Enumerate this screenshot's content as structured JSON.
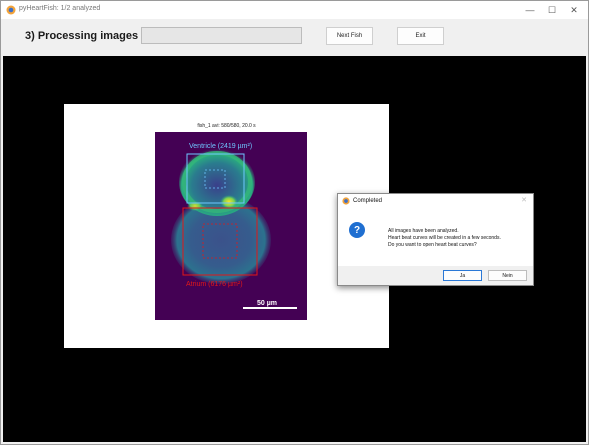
{
  "window": {
    "title": "pyHeartFish: 1/2 analyzed",
    "minimize_glyph": "—",
    "maximize_glyph": "☐",
    "close_glyph": "✕"
  },
  "toolbar": {
    "section_title": "3) Processing images",
    "progress": 0,
    "next_fish_label": "Next Fish",
    "exit_label": "Exit"
  },
  "image_panel": {
    "title": "fish_1 avi: 580/580, 20.0 s",
    "ventricle_label": "Ventricle (2419 µm²)",
    "atrium_label": "Atrium (6176 µm²)",
    "scalebar_label": "50 µm"
  },
  "dialog": {
    "title": "Completed",
    "icon": "question-icon",
    "message_lines": [
      "All images have been analyzed.",
      "Heart beat curves will be created in a few seconds.",
      "Do you want to open heart beat curves?"
    ],
    "yes_label": "Ja",
    "no_label": "Nein"
  },
  "colors": {
    "ventricle": "#6ec6ff",
    "atrium": "#e11818",
    "image_background": "#440154"
  }
}
